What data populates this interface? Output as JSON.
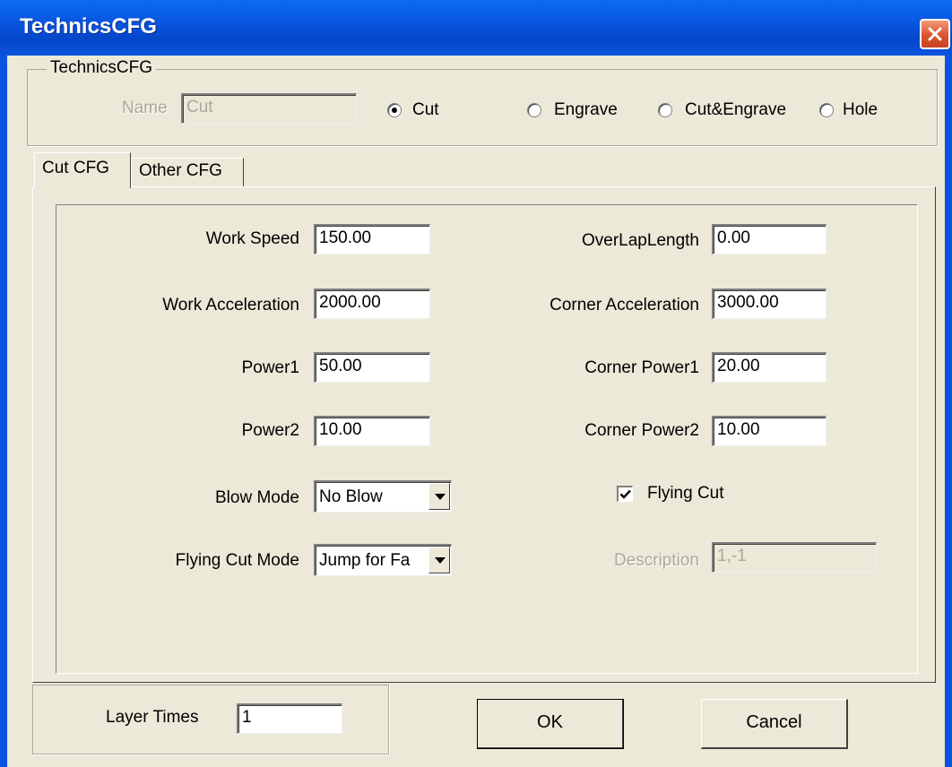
{
  "window": {
    "title": "TechnicsCFG"
  },
  "group": {
    "legend": "TechnicsCFG",
    "name_label": "Name",
    "name_value": "Cut",
    "radios": [
      {
        "label": "Cut",
        "checked": true
      },
      {
        "label": "Engrave",
        "checked": false
      },
      {
        "label": "Cut&Engrave",
        "checked": false
      },
      {
        "label": "Hole",
        "checked": false
      }
    ]
  },
  "tabs": [
    {
      "label": "Cut CFG",
      "active": true
    },
    {
      "label": "Other CFG",
      "active": false
    }
  ],
  "left_fields": {
    "work_speed": {
      "label": "Work Speed",
      "value": "150.00"
    },
    "work_acceleration": {
      "label": "Work Acceleration",
      "value": "2000.00"
    },
    "power1": {
      "label": "Power1",
      "value": "50.00"
    },
    "power2": {
      "label": "Power2",
      "value": "10.00"
    },
    "blow_mode": {
      "label": "Blow Mode",
      "value": "No Blow"
    },
    "flying_cut_mode": {
      "label": "Flying Cut Mode",
      "value": "Jump for Fa"
    }
  },
  "right_fields": {
    "overlap_length": {
      "label": "OverLapLength",
      "value": "0.00"
    },
    "corner_acceleration": {
      "label": "Corner Acceleration",
      "value": "3000.00"
    },
    "corner_power1": {
      "label": "Corner Power1",
      "value": "20.00"
    },
    "corner_power2": {
      "label": "Corner Power2",
      "value": "10.00"
    },
    "flying_cut": {
      "label": "Flying Cut",
      "checked": true
    },
    "description": {
      "label": "Description",
      "value": "1,-1"
    }
  },
  "layer_times": {
    "label": "Layer Times",
    "value": "1"
  },
  "buttons": {
    "ok": "OK",
    "cancel": "Cancel"
  },
  "colors": {
    "titlebar": "#0a58e4",
    "dialog_bg": "#ece9d8",
    "close_button": "#d9542c"
  }
}
